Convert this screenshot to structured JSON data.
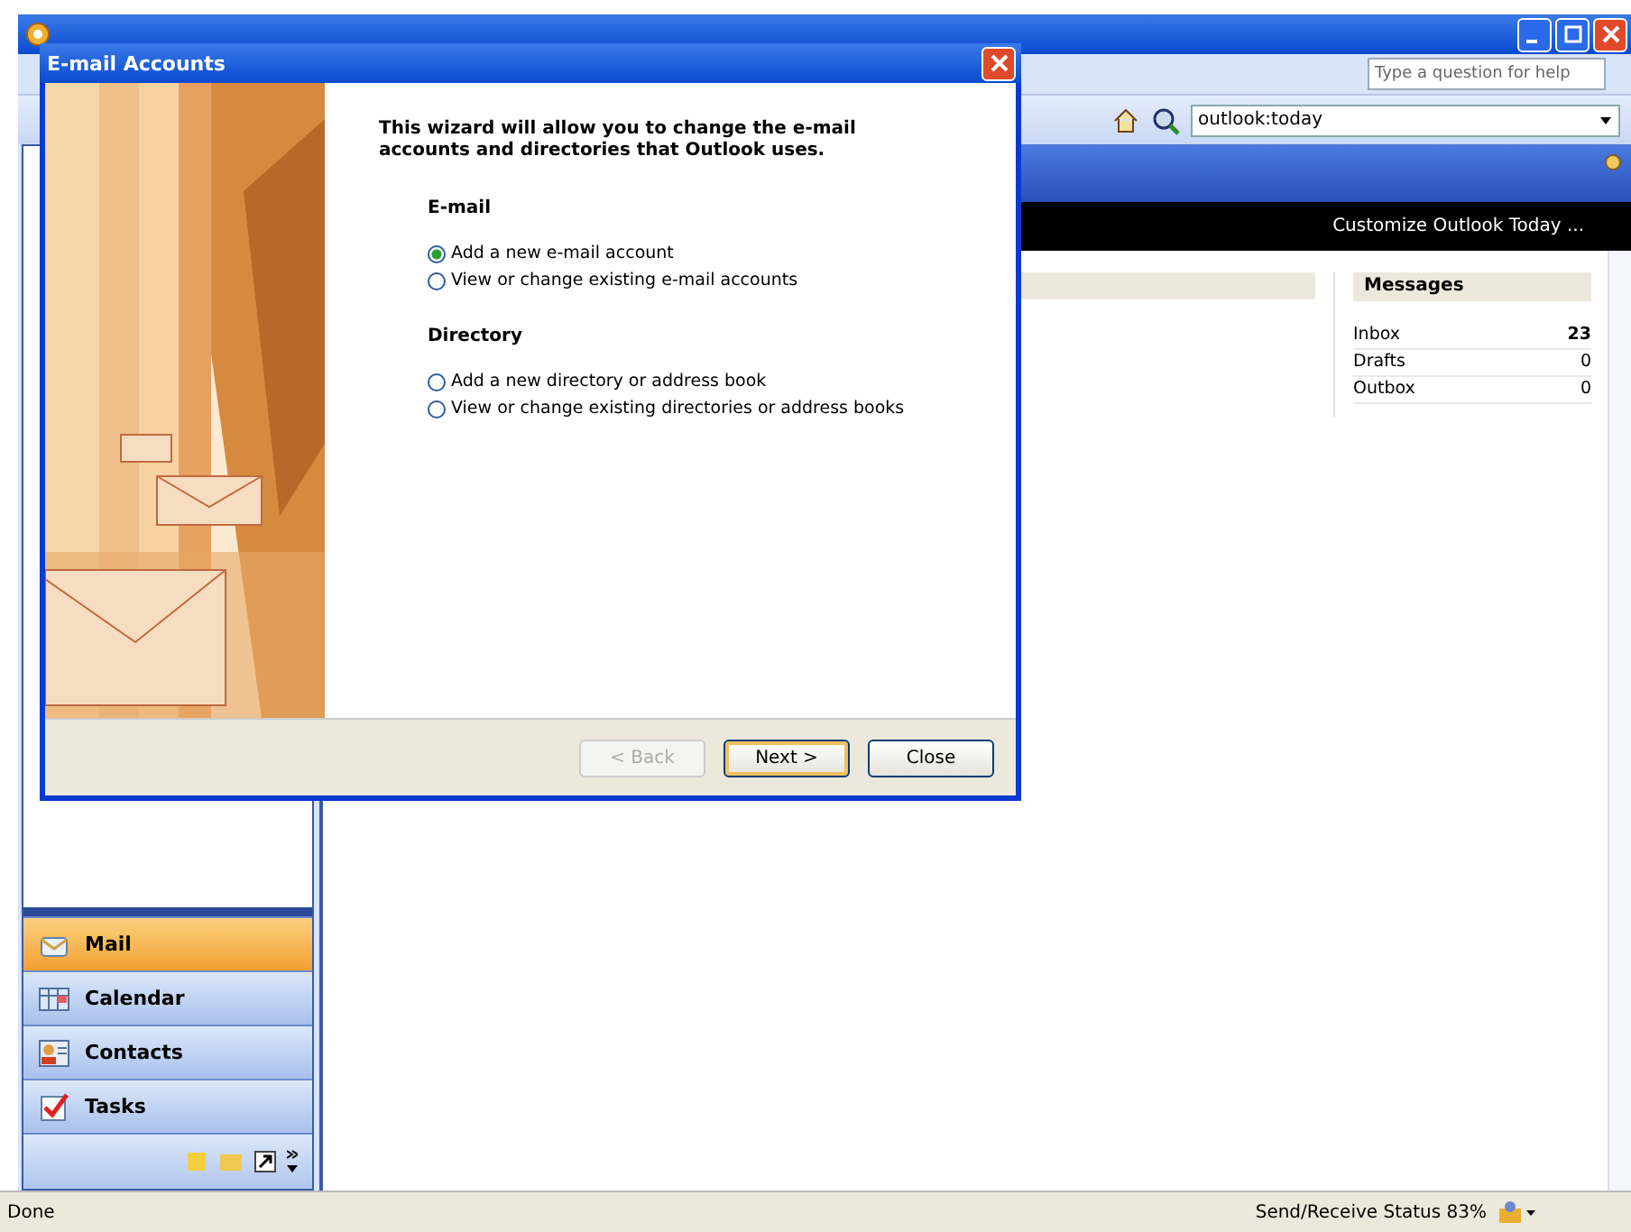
{
  "help_field": {
    "placeholder": "Type a question for help"
  },
  "address_field": {
    "value": "outlook:today"
  },
  "customize_link": "Customize Outlook Today ...",
  "messages": {
    "title": "Messages",
    "rows": [
      {
        "label": "Inbox",
        "count": "23",
        "unread": true
      },
      {
        "label": "Drafts",
        "count": "0",
        "unread": false
      },
      {
        "label": "Outbox",
        "count": "0",
        "unread": false
      }
    ]
  },
  "navigation": [
    {
      "label": "Mail",
      "kind": "mail",
      "selected": true
    },
    {
      "label": "Calendar",
      "kind": "calendar",
      "selected": false
    },
    {
      "label": "Contacts",
      "kind": "contacts",
      "selected": false
    },
    {
      "label": "Tasks",
      "kind": "tasks",
      "selected": false
    }
  ],
  "status_bar": {
    "left": "Done",
    "right": "Send/Receive Status 83%"
  },
  "dialog": {
    "title": "E-mail Accounts",
    "intro": "This wizard will allow you to change the e-mail accounts and directories that Outlook uses.",
    "sections": [
      {
        "heading": "E-mail",
        "options": [
          {
            "label": "Add a new e-mail account",
            "selected": true
          },
          {
            "label": "View or change existing e-mail accounts",
            "selected": false
          }
        ]
      },
      {
        "heading": "Directory",
        "options": [
          {
            "label": "Add a new directory or address book",
            "selected": false
          },
          {
            "label": "View or change existing directories or address books",
            "selected": false
          }
        ]
      }
    ],
    "buttons": [
      {
        "label": "< Back",
        "disabled": true,
        "default": false
      },
      {
        "label": "Next >",
        "disabled": false,
        "default": true
      },
      {
        "label": "Close",
        "disabled": false,
        "default": false
      }
    ]
  }
}
